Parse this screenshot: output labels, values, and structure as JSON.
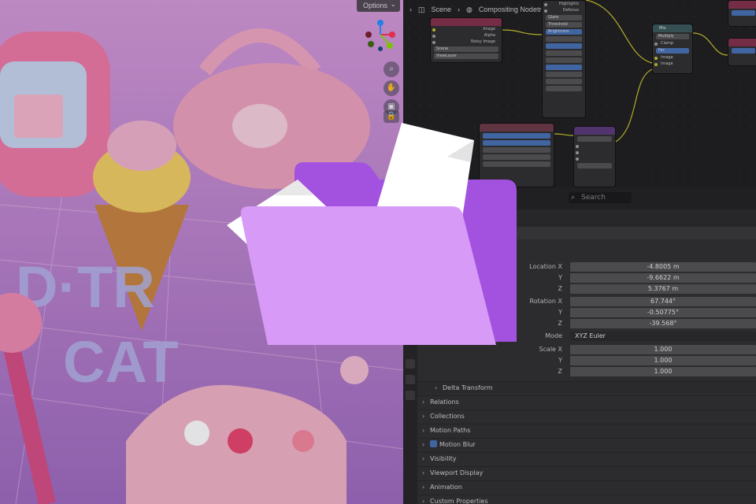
{
  "viewport": {
    "options_label": "Options",
    "tools": [
      "zoom-icon",
      "hand-icon",
      "camera-icon",
      "lock-icon"
    ]
  },
  "node_editor": {
    "breadcrumb": {
      "scene": "Scene",
      "nodetree": "Compositing Nodetree"
    },
    "nodes": {
      "render_layers": {
        "outputs": [
          "Image",
          "Alpha",
          "Noisy Image"
        ],
        "scene": "Scene",
        "layer": "ViewLayer"
      },
      "filter": {
        "outputs": [
          "Highlights",
          "Defocus"
        ],
        "fields": [
          "Glare",
          "Threshold",
          "Brightness"
        ]
      },
      "mix": {
        "title": "Mix",
        "fields": [
          "Multiply",
          "Clamp",
          "Fac"
        ],
        "inputs": [
          "Image",
          "Image"
        ]
      }
    }
  },
  "properties": {
    "search_placeholder": "Search",
    "transform": {
      "location": {
        "label": "Location X",
        "x": "-4.8005 m",
        "y": "-9.6622 m",
        "z": "5.3767 m"
      },
      "rotation": {
        "label": "Rotation X",
        "x": "67.744°",
        "y": "-0.50775°",
        "z": "-39.568°"
      },
      "mode": {
        "label": "Mode",
        "value": "XYZ Euler"
      },
      "scale": {
        "label": "Scale X",
        "x": "1.000",
        "y": "1.000",
        "z": "1.000"
      },
      "axis_y": "Y",
      "axis_z": "Z"
    },
    "sections": [
      "Delta Transform",
      "Relations",
      "Collections",
      "Motion Paths",
      "Motion Blur",
      "Visibility",
      "Viewport Display",
      "Animation",
      "Custom Properties"
    ]
  },
  "colors": {
    "folder_back": "#a352e0",
    "folder_front": "#d79bf7",
    "paper": "#ffffff",
    "accent_blue": "#4772b3"
  }
}
